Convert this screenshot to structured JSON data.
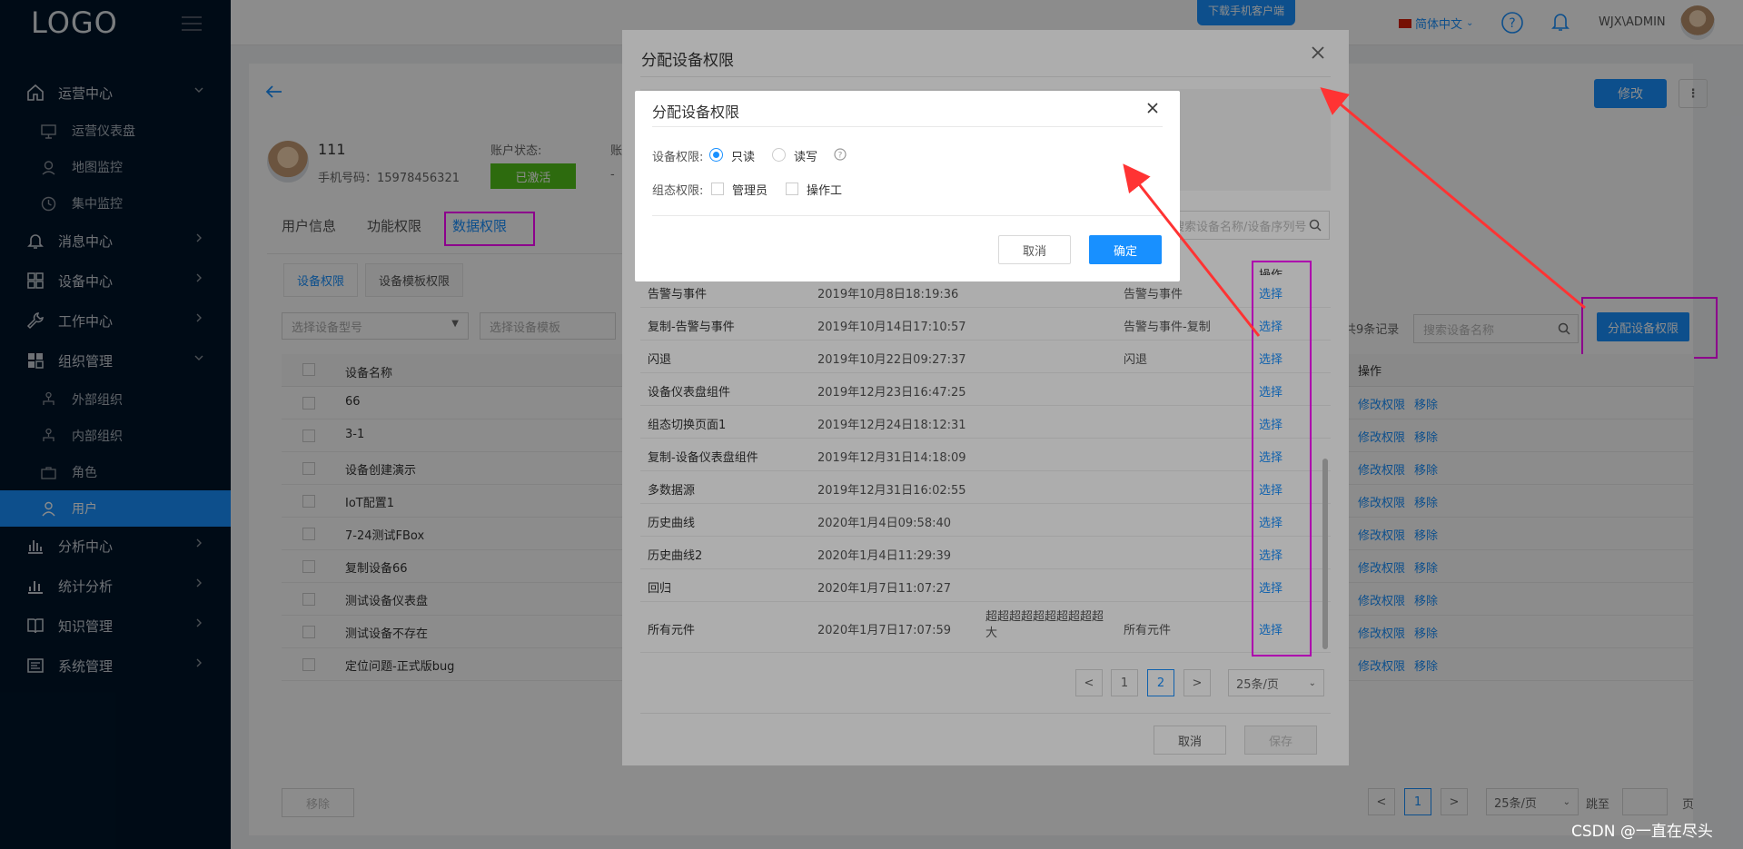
{
  "sidebar": {
    "logo": "LOGO",
    "menu": [
      {
        "label": "运营中心",
        "icon": "home-icon"
      },
      {
        "label": "消息中心",
        "icon": "bell-icon"
      },
      {
        "label": "设备中心",
        "icon": "grid-icon"
      },
      {
        "label": "工作中心",
        "icon": "wrench-icon"
      },
      {
        "label": "组织管理",
        "icon": "org-icon"
      },
      {
        "label": "分析中心",
        "icon": "bar-chart-icon"
      },
      {
        "label": "统计分析",
        "icon": "stats-icon"
      },
      {
        "label": "知识管理",
        "icon": "book-icon"
      },
      {
        "label": "系统管理",
        "icon": "settings-icon"
      }
    ],
    "ops_sub": [
      "运营仪表盘",
      "地图监控",
      "集中监控"
    ],
    "org_sub": [
      "外部组织",
      "内部组织",
      "角色",
      "用户"
    ],
    "active_item": "用户"
  },
  "header": {
    "download_app": "下载手机客户端",
    "language": "简体中文",
    "username": "WJX\\ADMIN"
  },
  "user": {
    "name": "111",
    "phone": "手机号码：15978456321",
    "status_label": "账户状态:",
    "status_value": "已激活",
    "second_label": "账",
    "second_value": "-"
  },
  "page": {
    "edit_button": "修改",
    "more_button": "⋮",
    "tabs": [
      "用户信息",
      "功能权限",
      "数据权限"
    ],
    "subtabs": [
      "设备权限",
      "设备模板权限"
    ],
    "model_select_placeholder": "选择设备型号",
    "template_select_placeholder": "选择设备模板",
    "total_records": "共9条记录",
    "search_placeholder": "搜索设备名称",
    "assign_button": "分配设备权限",
    "table_header_name": "设备名称",
    "table_header_op": "操作",
    "row_op_modify": "修改权限",
    "row_op_remove": "移除",
    "rows": [
      "66",
      "3-1",
      "设备创建演示",
      "IoT配置1",
      "7-24测试FBox",
      "复制设备66",
      "测试设备仪表盘",
      "测试设备不存在",
      "定位问题-正式版bug"
    ],
    "remove_button": "移除",
    "pager": {
      "prev": "<",
      "page": "1",
      "next": ">",
      "size": "25条/页",
      "goto": "跳至",
      "unit": "页"
    }
  },
  "outer_modal": {
    "title": "分配设备权限",
    "search_placeholder": "搜索设备名称/设备序列号",
    "op_header": "操作",
    "rows": [
      {
        "name": "告警与事件",
        "time": "2019年10月8日18:19:36",
        "desc": "",
        "type": "告警与事件",
        "op": "选择"
      },
      {
        "name": "复制-告警与事件",
        "time": "2019年10月14日17:10:57",
        "desc": "",
        "type": "告警与事件-复制",
        "op": "选择"
      },
      {
        "name": "闪退",
        "time": "2019年10月22日09:27:37",
        "desc": "",
        "type": "闪退",
        "op": "选择"
      },
      {
        "name": "设备仪表盘组件",
        "time": "2019年12月23日16:47:25",
        "desc": "",
        "type": "",
        "op": "选择"
      },
      {
        "name": "组态切换页面1",
        "time": "2019年12月24日18:12:31",
        "desc": "",
        "type": "",
        "op": "选择"
      },
      {
        "name": "复制-设备仪表盘组件",
        "time": "2019年12月31日14:18:09",
        "desc": "",
        "type": "",
        "op": "选择"
      },
      {
        "name": "多数据源",
        "time": "2019年12月31日16:02:55",
        "desc": "",
        "type": "",
        "op": "选择"
      },
      {
        "name": "历史曲线",
        "time": "2020年1月4日09:58:40",
        "desc": "",
        "type": "",
        "op": "选择"
      },
      {
        "name": "历史曲线2",
        "time": "2020年1月4日11:29:39",
        "desc": "",
        "type": "",
        "op": "选择"
      },
      {
        "name": "回归",
        "time": "2020年1月7日11:07:27",
        "desc": "",
        "type": "",
        "op": "选择"
      },
      {
        "name": "所有元件",
        "time": "2020年1月7日17:07:59",
        "desc": "超超超超超超超超超超大",
        "type": "所有元件",
        "op": "选择"
      }
    ],
    "pager": {
      "prev": "<",
      "page1": "1",
      "page2": "2",
      "next": ">",
      "size": "25条/页"
    },
    "cancel_button": "取消",
    "save_button": "保存"
  },
  "inner_modal": {
    "title": "分配设备权限",
    "perm_label": "设备权限:",
    "radio_readonly": "只读",
    "radio_readwrite": "读写",
    "role_label": "组态权限:",
    "checkbox_admin": "管理员",
    "checkbox_operator": "操作工",
    "cancel_button": "取消",
    "ok_button": "确定",
    "selected_permission": "只读"
  },
  "watermark": "CSDN @一直在尽头",
  "colors": {
    "sidebar_bg": "#001529",
    "primary": "#1890ff",
    "success": "#52c41a",
    "highlight": "#ff00ff",
    "arrow": "#ff3333"
  }
}
